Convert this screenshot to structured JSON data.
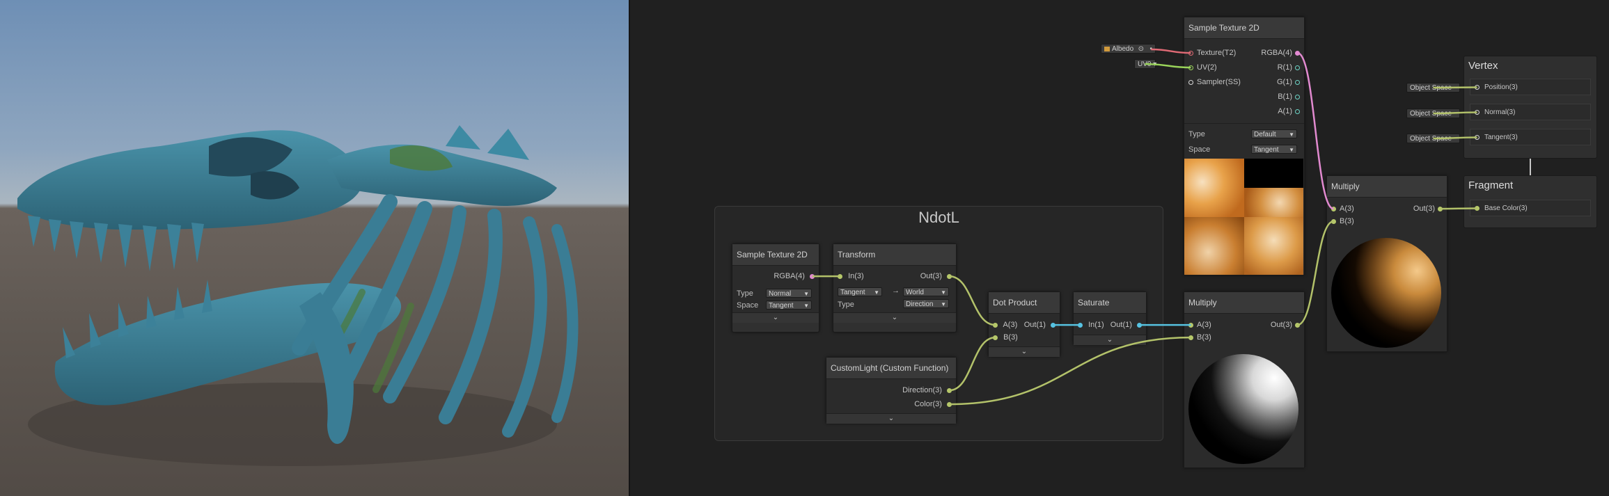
{
  "viewport": {
    "sky_color": "#7c99b9",
    "ground_color": "#5d5650",
    "model_color": "#3f7f94",
    "model_shadow": "#2a5667",
    "moss_color": "#5a7a3c"
  },
  "graph": {
    "group": {
      "title": "NdotL"
    },
    "nodes": {
      "sample_texture_group": {
        "title": "Sample Texture 2D",
        "out_rgba": "RGBA(4)",
        "type_label": "Type",
        "type_value": "Normal",
        "space_label": "Space",
        "space_value": "Tangent"
      },
      "transform": {
        "title": "Transform",
        "in_label": "In(3)",
        "out_label": "Out(3)",
        "from_value": "Tangent",
        "arrow": "→",
        "to_value": "World",
        "type_label": "Type",
        "type_value": "Direction"
      },
      "dot_product": {
        "title": "Dot Product",
        "in_a": "A(3)",
        "in_b": "B(3)",
        "out": "Out(1)"
      },
      "saturate": {
        "title": "Saturate",
        "in": "In(1)",
        "out": "Out(1)"
      },
      "custom_light": {
        "title": "CustomLight (Custom Function)",
        "out_direction": "Direction(3)",
        "out_color": "Color(3)"
      },
      "sample_texture_top": {
        "title": "Sample Texture 2D",
        "in_texture": "Texture(T2)",
        "in_uv": "UV(2)",
        "in_sampler": "Sampler(SS)",
        "out_rgba": "RGBA(4)",
        "out_r": "R(1)",
        "out_g": "G(1)",
        "out_b": "B(1)",
        "out_a": "A(1)",
        "type_label": "Type",
        "type_value": "Default",
        "space_label": "Space",
        "space_value": "Tangent",
        "albedo_field": "Albedo",
        "uv_field": "UV0"
      },
      "multiply_bottom": {
        "title": "Multiply",
        "in_a": "A(3)",
        "in_b": "B(3)",
        "out": "Out(3)"
      },
      "multiply_right": {
        "title": "Multiply",
        "in_a": "A(3)",
        "in_b": "B(3)",
        "out": "Out(3)"
      }
    },
    "vertex": {
      "title": "Vertex",
      "slots": [
        {
          "space": "Object Space",
          "label": "Position(3)"
        },
        {
          "space": "Object Space",
          "label": "Normal(3)"
        },
        {
          "space": "Object Space",
          "label": "Tangent(3)"
        }
      ]
    },
    "fragment": {
      "title": "Fragment",
      "slots": [
        {
          "label": "Base Color(3)"
        }
      ]
    },
    "colors": {
      "wire_vector": "#b3c26a",
      "wire_float": "#56c2e0",
      "wire_rgba": "#e28ad0"
    }
  }
}
